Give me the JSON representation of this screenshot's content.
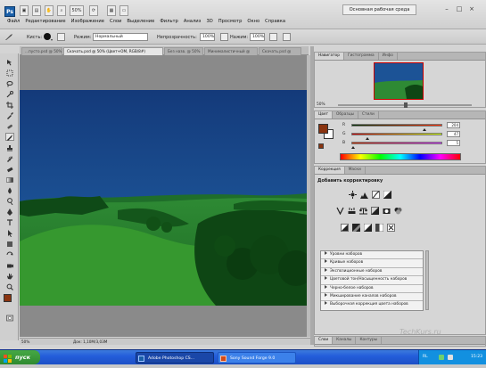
{
  "menubar": {
    "logo": "Ps",
    "zoom": "50%",
    "items": [
      "Файл",
      "Редактирование",
      "Изображение",
      "Слои",
      "Выделение",
      "Фильтр",
      "Анализ",
      "3D",
      "Просмотр",
      "Окно",
      "Справка"
    ],
    "workspace": "Основная рабочая среда"
  },
  "options": {
    "brush_label": "Кисть:",
    "mode_label": "Режим:",
    "mode_value": "Нормальный",
    "opacity_label": "Непрозрачность:",
    "opacity_value": "100%",
    "pressure_label": "Нажим:",
    "pressure_value": "100%"
  },
  "document": {
    "tabs": [
      "...пусто.psd @ 50%",
      "Скачать.psd @ 50% (Цвет+ОМ, RGB/8#)",
      "Без назв. @ 50%",
      "Минималистичный @",
      "Скачать.psd @"
    ],
    "active_tab": 1,
    "status_zoom": "50%",
    "status_doc": "Док: 1,10М/3,03М"
  },
  "navigator": {
    "tabs": [
      "Навигатор",
      "Гистограмма",
      "Инфо"
    ],
    "zoom_value": "50%"
  },
  "color_panel": {
    "tabs": [
      "Цвет",
      "Образцы",
      "Стили"
    ],
    "channels": [
      {
        "label": "R",
        "value": "204",
        "marker": 0.8
      },
      {
        "label": "G",
        "value": "47",
        "marker": 0.18
      },
      {
        "label": "B",
        "value": "5",
        "marker": 0.02
      }
    ],
    "fg_color": "#8a3410",
    "bg_color": "#ffffff"
  },
  "adjustments": {
    "tabs": [
      "Коррекция",
      "Маски"
    ],
    "title": "Добавить корректировку",
    "items": [
      "Уровни наборов",
      "Кривые наборов",
      "Экспозиционные наборов",
      "Цветовой тон/Насыщенность наборов",
      "Черно-белое наборов",
      "Микширование каналов наборов",
      "Выборочная коррекция цвета наборов"
    ]
  },
  "layers_panel": {
    "tabs": [
      "Слои",
      "Каналы",
      "Контуры"
    ]
  },
  "taskbar": {
    "start": "пуск",
    "tasks": [
      "Adobe Photoshop CS...",
      "Sony Sound Forge 9.0"
    ],
    "tray_lang": "RL",
    "clock": "15:23"
  },
  "watermark": "TechKurs.ru",
  "colors": {
    "sky": "#1b4f8f",
    "grass": "#2f8a32",
    "taskbar": "#245edb",
    "ps_blue": "#1a5fa8"
  }
}
